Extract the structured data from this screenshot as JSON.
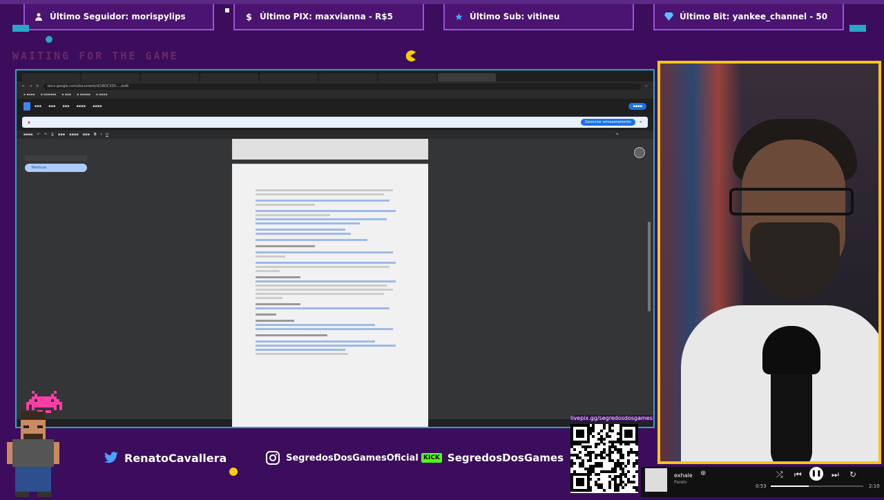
{
  "alerts": [
    {
      "icon": "user-icon",
      "label": "Último Seguidor: morispylips"
    },
    {
      "icon": "dollar-icon",
      "label": "Último PIX: maxvianna - R$5"
    },
    {
      "icon": "star-icon",
      "label": "Último Sub: vitineu"
    },
    {
      "icon": "diamond-icon",
      "label": "Último Bit: yankee_channel - 50"
    }
  ],
  "waiting_text": "WAITING FOR THE GAME",
  "socials": [
    {
      "icon": "twitter-icon",
      "label": "RenatoCavallera"
    },
    {
      "icon": "instagram-icon",
      "label": "SegredosDosGamesOficial"
    },
    {
      "icon": "kick-icon",
      "badge": "KICK",
      "label": "SegredosDosGames"
    }
  ],
  "qr_label": "livepix.gg/segredosdosgames",
  "browser": {
    "url": "docs.google.com/document/d/1BOC3Dh..../edit",
    "banner_button": "Gerenciar armazenamento",
    "outline_item": "Nenhum"
  },
  "player": {
    "title": "exhale",
    "artist": "Parelo",
    "elapsed": "0:53",
    "duration": "2:10",
    "progress": 0.41
  },
  "colors": {
    "background": "#3b0d5c",
    "frame_accent": "#2aa6c9",
    "cam_border": "#f5c518",
    "alert_border": "#9b54d8"
  }
}
